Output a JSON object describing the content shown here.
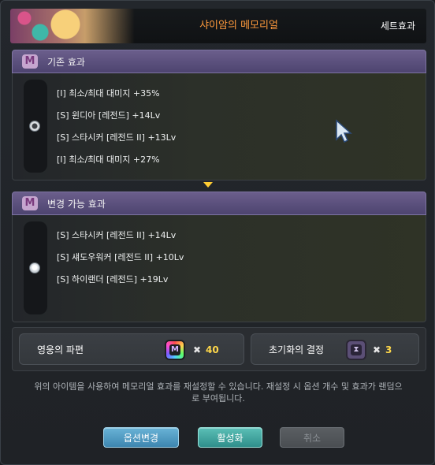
{
  "header": {
    "title": "샤이암의 메모리얼",
    "set_effect_label": "세트효과"
  },
  "current_section": {
    "title": "기존 효과",
    "lines": [
      "[I] 최소/최대 대미지 +35%",
      "[S] 윈디아 [레전드] +14Lv",
      "[S] 스타시커 [레전드 II] +13Lv",
      "[I] 최소/최대 대미지 +27%"
    ],
    "selected": true
  },
  "changeable_section": {
    "title": "변경 가능 효과",
    "lines": [
      "[S] 스타시커 [레전드 II] +14Lv",
      "[S] 섀도우워커 [레전드 II] +10Lv",
      "[S] 하이랜더 [레전드] +19Lv"
    ],
    "selected": false
  },
  "costs": [
    {
      "name": "영웅의 파편",
      "icon": "hero-fragment-icon",
      "quantity": "40"
    },
    {
      "name": "초기화의 결정",
      "icon": "reset-crystal-icon",
      "quantity": "3"
    }
  ],
  "multiply_symbol": "✖",
  "description": "위의 아이템을 사용하여 메모리얼 효과를 재설정할 수 있습니다. 재설정 시 옵션 개수 및 효과가 랜덤으로 부여됩니다.",
  "buttons": {
    "change_options": "옵션변경",
    "activate": "활성화",
    "cancel": "취소"
  },
  "icon_glyphs": {
    "m_icon": "M"
  },
  "colors": {
    "title": "#ff9a3c",
    "quantity": "#ffd84a",
    "section_bar": "#5a4f7d"
  }
}
